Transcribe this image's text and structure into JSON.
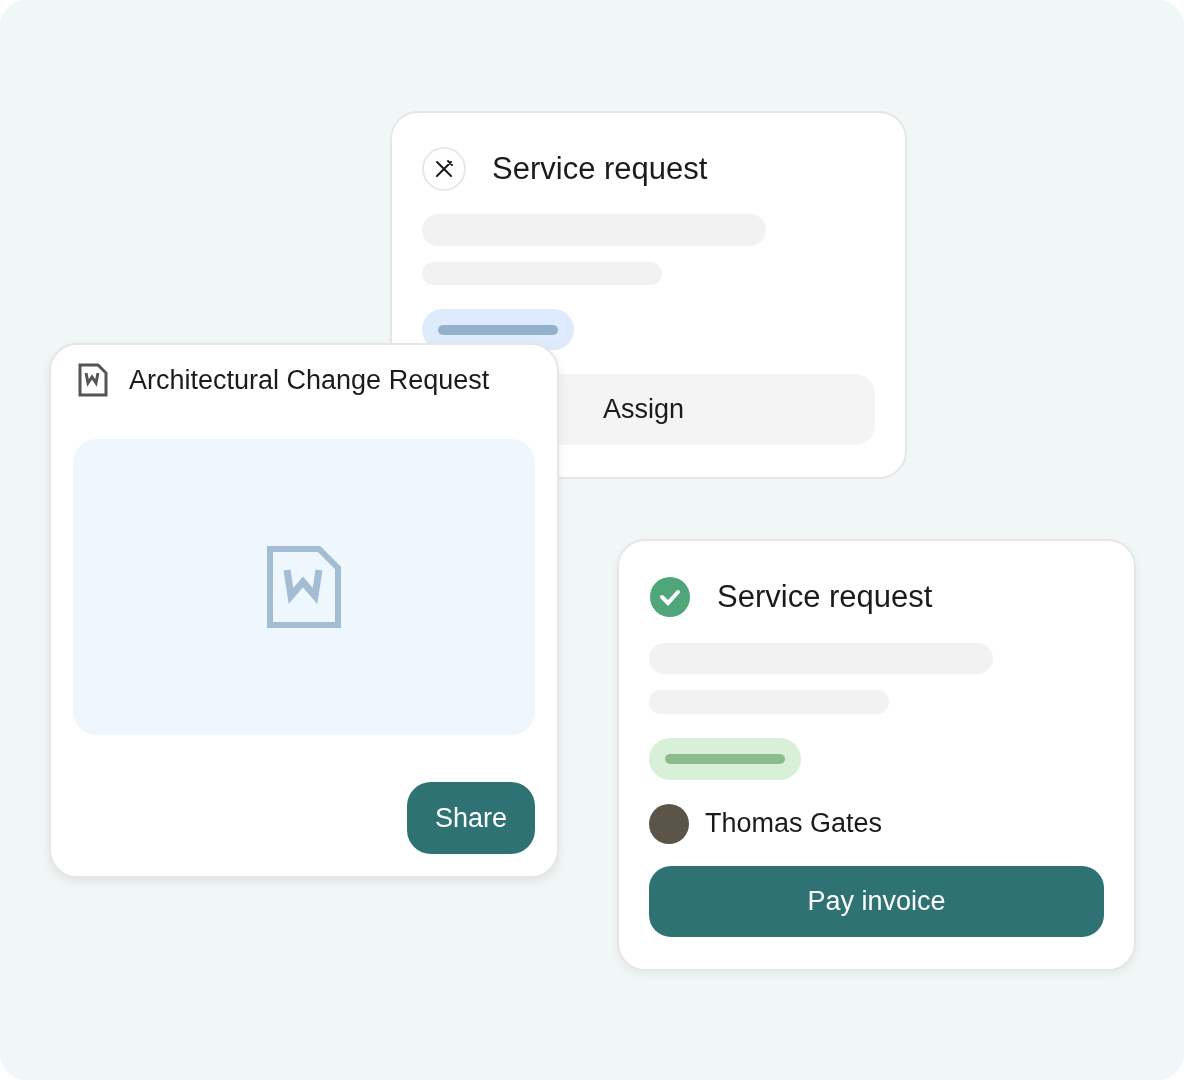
{
  "request_card": {
    "title": "Service request",
    "completed": false,
    "button": "Assign"
  },
  "document_card": {
    "title": "Architectural Change Request",
    "button": "Share"
  },
  "paid_card": {
    "title": "Service request",
    "completed": true,
    "assignee": "Thomas Gates",
    "button": "Pay invoice"
  }
}
